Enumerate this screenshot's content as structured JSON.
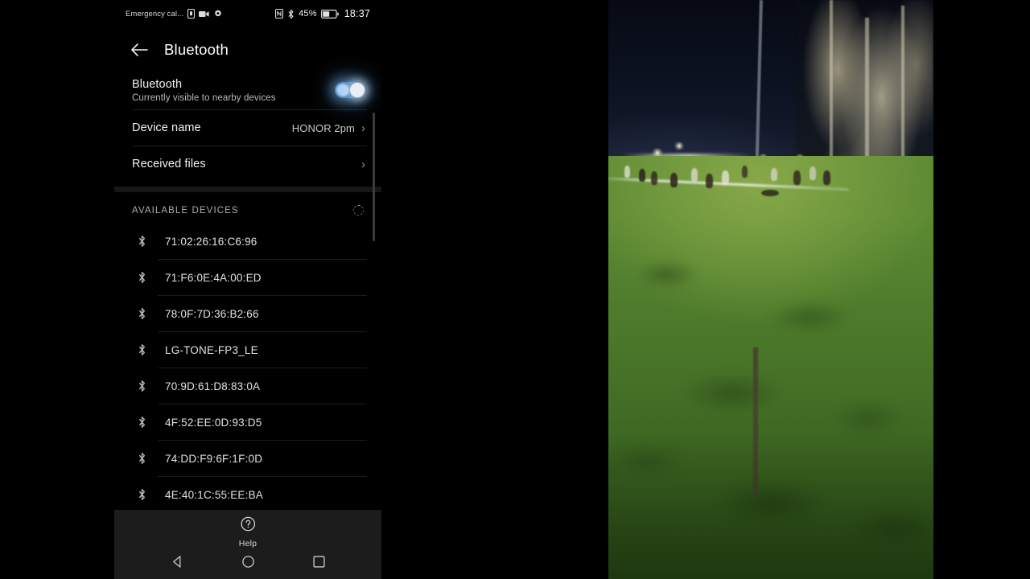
{
  "statusbar": {
    "carrier_text": "Emergency cal...",
    "left_icons": [
      "sim-card-icon",
      "video-camera-icon",
      "gear-icon"
    ],
    "right_icons": [
      "nfc-icon",
      "bluetooth-icon"
    ],
    "battery_percent": "45%",
    "battery_icon": "battery-icon",
    "time": "18:37"
  },
  "appbar": {
    "back_icon": "back-arrow-icon",
    "title": "Bluetooth"
  },
  "bluetooth_toggle": {
    "title": "Bluetooth",
    "subtitle": "Currently visible to nearby devices",
    "state": "on"
  },
  "rows": [
    {
      "title": "Device name",
      "value": "HONOR 2pm",
      "chevron": "›"
    },
    {
      "title": "Received files",
      "value": "",
      "chevron": "›"
    }
  ],
  "available_section": {
    "label": "AVAILABLE DEVICES",
    "scanning_icon": "scanning-spinner-icon"
  },
  "devices": [
    {
      "icon": "bluetooth-icon",
      "name": "71:02:26:16:C6:96"
    },
    {
      "icon": "bluetooth-icon",
      "name": "71:F6:0E:4A:00:ED"
    },
    {
      "icon": "bluetooth-icon",
      "name": "78:0F:7D:36:B2:66"
    },
    {
      "icon": "bluetooth-icon",
      "name": "LG-TONE-FP3_LE"
    },
    {
      "icon": "bluetooth-icon",
      "name": "70:9D:61:D8:83:0A"
    },
    {
      "icon": "bluetooth-icon",
      "name": "4F:52:EE:0D:93:D5"
    },
    {
      "icon": "bluetooth-icon",
      "name": "74:DD:F9:6F:1F:0D"
    },
    {
      "icon": "bluetooth-icon",
      "name": "4E:40:1C:55:EE:BA"
    }
  ],
  "bottombar": {
    "help_icon": "help-circle-icon",
    "help_label": "Help",
    "nav": [
      {
        "icon": "back-triangle-icon",
        "name": "back"
      },
      {
        "icon": "home-circle-icon",
        "name": "home"
      },
      {
        "icon": "recents-square-icon",
        "name": "recents"
      }
    ]
  },
  "video_panel": {
    "description": "night-rugby-match-video",
    "sky_color": "#0d1322",
    "pitch_color": "#4f7d2c",
    "tree_color": "#c6bea0"
  },
  "colors": {
    "background": "#000000",
    "accent_toggle": "#4a7fb5",
    "text_primary": "#f0f0f0",
    "text_secondary": "#b9b9b9",
    "bottombar_bg": "#1c1c1c"
  }
}
